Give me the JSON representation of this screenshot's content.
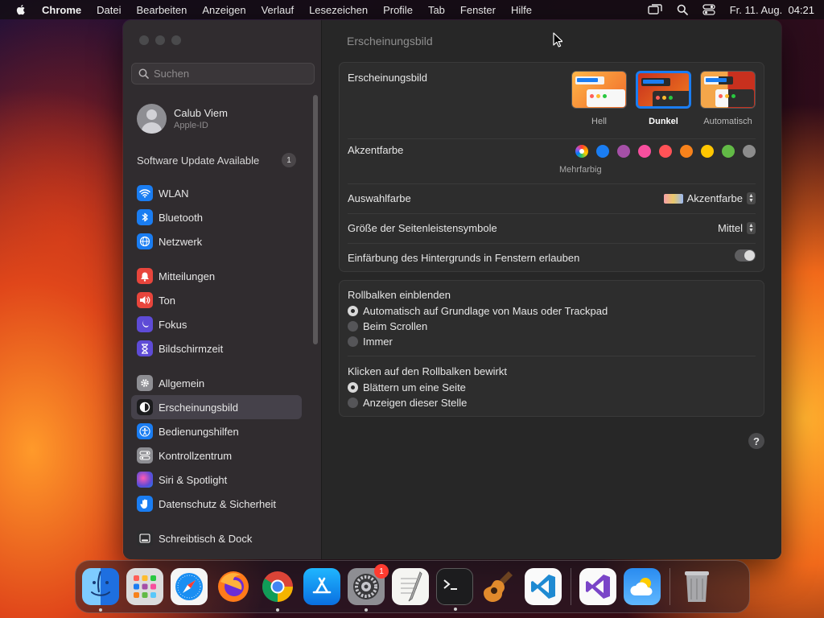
{
  "menubar": {
    "app_name": "Chrome",
    "items": [
      "Datei",
      "Bearbeiten",
      "Anzeigen",
      "Verlauf",
      "Lesezeichen",
      "Profile",
      "Tab",
      "Fenster",
      "Hilfe"
    ],
    "clock": "Fr. 11. Aug.  04:21"
  },
  "sidebar": {
    "search_placeholder": "Suchen",
    "profile": {
      "name": "Calub Viem",
      "subtitle": "Apple-ID"
    },
    "update": {
      "label": "Software Update Available",
      "count": "1"
    },
    "items": [
      {
        "label": "WLAN",
        "icon": "wifi-icon",
        "color": "#1a7df2"
      },
      {
        "label": "Bluetooth",
        "icon": "bluetooth-icon",
        "color": "#1a7df2"
      },
      {
        "label": "Netzwerk",
        "icon": "globe-icon",
        "color": "#1a7df2"
      },
      {
        "label": "Mitteilungen",
        "icon": "bell-icon",
        "color": "#e8453c"
      },
      {
        "label": "Ton",
        "icon": "speaker-icon",
        "color": "#e8453c"
      },
      {
        "label": "Fokus",
        "icon": "moon-icon",
        "color": "#5e4bd6"
      },
      {
        "label": "Bildschirmzeit",
        "icon": "hourglass-icon",
        "color": "#5e4bd6"
      },
      {
        "label": "Allgemein",
        "icon": "gear-icon",
        "color": "#8e8e93"
      },
      {
        "label": "Erscheinungsbild",
        "icon": "appearance-icon",
        "color": "#1c1c1e"
      },
      {
        "label": "Bedienungshilfen",
        "icon": "accessibility-icon",
        "color": "#1a7df2"
      },
      {
        "label": "Kontrollzentrum",
        "icon": "control-center-icon",
        "color": "#8e8e93"
      },
      {
        "label": "Siri & Spotlight",
        "icon": "siri-icon",
        "color": "#b04be0"
      },
      {
        "label": "Datenschutz & Sicherheit",
        "icon": "hand-icon",
        "color": "#1a7df2"
      },
      {
        "label": "Schreibtisch & Dock",
        "icon": "dock-icon",
        "color": "#2c2c2e"
      }
    ],
    "selected": "Erscheinungsbild"
  },
  "content": {
    "title": "Erscheinungsbild",
    "appearance": {
      "label": "Erscheinungsbild",
      "options": [
        "Hell",
        "Dunkel",
        "Automatisch"
      ],
      "selected": "Dunkel"
    },
    "accent": {
      "label": "Akzentfarbe",
      "caption": "Mehrfarbig",
      "colors": [
        "multicolor",
        "#1a7df2",
        "#a550a7",
        "#f74f9e",
        "#ff5257",
        "#f7821b",
        "#ffc600",
        "#62ba46",
        "#8c8c8c"
      ]
    },
    "highlight": {
      "label": "Auswahlfarbe",
      "value": "Akzentfarbe"
    },
    "sidebar_icon_size": {
      "label": "Größe der Seitenleistensymbole",
      "value": "Mittel"
    },
    "wallpaper_tinting": {
      "label": "Einfärbung des Hintergrunds in Fenstern erlauben",
      "enabled": true
    },
    "scrollbars": {
      "label": "Rollbalken einblenden",
      "options": [
        "Automatisch auf Grundlage von Maus oder Trackpad",
        "Beim Scrollen",
        "Immer"
      ],
      "selected": "Automatisch auf Grundlage von Maus oder Trackpad"
    },
    "scroll_click": {
      "label": "Klicken auf den Rollbalken bewirkt",
      "options": [
        "Blättern um eine Seite",
        "Anzeigen dieser Stelle"
      ],
      "selected": "Blättern um eine Seite"
    },
    "help": "?"
  },
  "dock": {
    "apps": [
      {
        "name": "Finder",
        "icon": "finder-icon",
        "running": true
      },
      {
        "name": "Launchpad",
        "icon": "launchpad-icon",
        "running": false
      },
      {
        "name": "Safari",
        "icon": "safari-icon",
        "running": false
      },
      {
        "name": "Firefox",
        "icon": "firefox-icon",
        "running": false
      },
      {
        "name": "Chrome",
        "icon": "chrome-icon",
        "running": true
      },
      {
        "name": "App Store",
        "icon": "app-store-icon",
        "running": false
      },
      {
        "name": "Systemeinstellungen",
        "icon": "system-settings-icon",
        "running": true,
        "badge": "1"
      },
      {
        "name": "TextEdit",
        "icon": "textedit-icon",
        "running": false
      },
      {
        "name": "Terminal",
        "icon": "terminal-icon",
        "running": true
      },
      {
        "name": "GarageBand",
        "icon": "garageband-icon",
        "running": false
      },
      {
        "name": "Visual Studio Code",
        "icon": "vscode-icon",
        "running": false
      }
    ],
    "recent": [
      {
        "name": "Visual Studio",
        "icon": "visual-studio-icon",
        "running": false
      },
      {
        "name": "Wetter",
        "icon": "weather-icon",
        "running": false
      }
    ],
    "trash": {
      "name": "Papierkorb",
      "icon": "trash-icon"
    }
  }
}
